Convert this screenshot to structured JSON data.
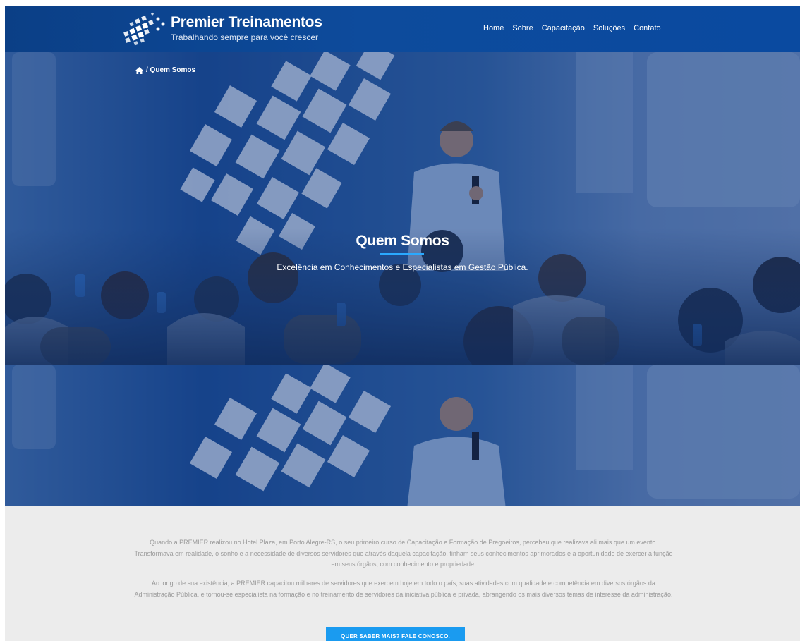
{
  "header": {
    "brand": "Premier Treinamentos",
    "tagline": "Trabalhando sempre para você crescer",
    "nav": [
      {
        "label": "Home"
      },
      {
        "label": "Sobre"
      },
      {
        "label": "Capacitação"
      },
      {
        "label": "Soluções"
      },
      {
        "label": "Contato"
      }
    ]
  },
  "breadcrumb": {
    "icon": "home-icon",
    "label": "/ Quem Somos"
  },
  "hero": {
    "title": "Quem Somos",
    "subtitle": "Excelência em Conhecimentos e Especialistas em Gestão Pública."
  },
  "content": {
    "paragraph1": "Quando a PREMIER realizou no Hotel Plaza, em Porto Alegre-RS, o seu primeiro curso de Capacitação e Formação de Pregoeiros, percebeu que realizava ali mais que um evento. Transformava em realidade, o sonho e a necessidade de diversos servidores que através daquela capacitação, tinham seus conhecimentos aprimorados e a oportunidade de exercer a função em seus órgãos, com conhecimento e propriedade.",
    "paragraph2": "Ao longo de sua existência, a PREMIER capacitou milhares de servidores que exercem hoje em todo o país, suas atividades com qualidade e competência em diversos órgãos da Administração Pública, e tornou-se especialista na formação e no treinamento de servidores da iniciativa pública e privada, abrangendo os mais diversos temas de interesse da administração.",
    "cta": "QUER SABER MAIS? FALE CONOSCO."
  },
  "colors": {
    "header": "#0d4b9c",
    "accent": "#1a9bf0",
    "content_bg": "#ececec",
    "text_muted": "#9a9a9a"
  }
}
